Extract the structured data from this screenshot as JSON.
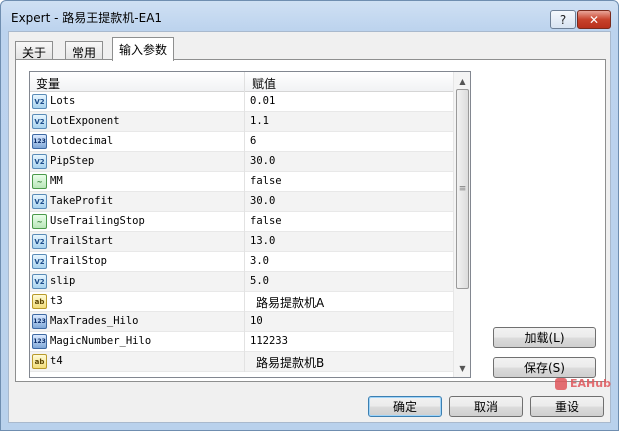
{
  "window": {
    "title": "Expert - 路易王提款机-EA1",
    "help_label": "?",
    "close_label": "✕"
  },
  "tabs": [
    {
      "label": "关于",
      "active": false
    },
    {
      "label": "常用",
      "active": false
    },
    {
      "label": "输入参数",
      "active": true
    }
  ],
  "grid": {
    "columns": [
      "变量",
      "赋值"
    ],
    "rows": [
      {
        "icon": "double-icon",
        "badge": "V2",
        "name": "Lots",
        "value": "0.01"
      },
      {
        "icon": "double-icon",
        "badge": "V2",
        "name": "LotExponent",
        "value": "1.1"
      },
      {
        "icon": "integer-icon",
        "badge": "123",
        "name": "lotdecimal",
        "value": "6"
      },
      {
        "icon": "double-icon",
        "badge": "V2",
        "name": "PipStep",
        "value": "30.0"
      },
      {
        "icon": "boolean-icon",
        "badge": "~",
        "name": "MM",
        "value": "false"
      },
      {
        "icon": "double-icon",
        "badge": "V2",
        "name": "TakeProfit",
        "value": "30.0"
      },
      {
        "icon": "boolean-icon",
        "badge": "~",
        "name": "UseTrailingStop",
        "value": "false"
      },
      {
        "icon": "double-icon",
        "badge": "V2",
        "name": "TrailStart",
        "value": "13.0"
      },
      {
        "icon": "double-icon",
        "badge": "V2",
        "name": "TrailStop",
        "value": "3.0"
      },
      {
        "icon": "double-icon",
        "badge": "V2",
        "name": "slip",
        "value": "5.0"
      },
      {
        "icon": "string-icon",
        "badge": "ab",
        "name": "t3",
        "value": "路易提款机A"
      },
      {
        "icon": "integer-icon",
        "badge": "123",
        "name": "MaxTrades_Hilo",
        "value": "10"
      },
      {
        "icon": "integer-icon",
        "badge": "123",
        "name": "MagicNumber_Hilo",
        "value": "112233"
      },
      {
        "icon": "string-icon",
        "badge": "ab",
        "name": "t4",
        "value": "路易提款机B"
      }
    ]
  },
  "buttons": {
    "load": "加载(L)",
    "save": "保存(S)",
    "ok": "确定",
    "cancel": "取消",
    "reset": "重设"
  },
  "watermark": "EAHub"
}
